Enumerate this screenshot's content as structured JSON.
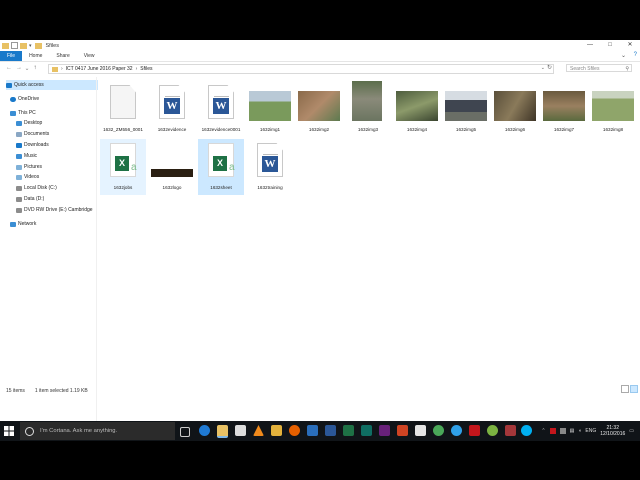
{
  "window": {
    "title": "Sfiles",
    "controls": {
      "minimize": "—",
      "maximize": "□",
      "close": "✕"
    }
  },
  "ribbon": {
    "tabs": [
      "File",
      "Home",
      "Share",
      "View"
    ],
    "help": "?"
  },
  "address": {
    "back": "←",
    "forward": "→",
    "recent": "⌄",
    "up": "↑",
    "path": [
      "ICT 0417 June 2016 Paper 32",
      "Sfiles"
    ],
    "separator": "›",
    "search_placeholder": "Search Sfiles"
  },
  "nav": {
    "items": [
      {
        "label": "Quick access",
        "icon": "star-icon",
        "color": "#1979ca"
      },
      {
        "label": "OneDrive",
        "icon": "cloud-icon",
        "color": "#1979ca"
      },
      {
        "label": "This PC",
        "icon": "computer-icon",
        "color": "#3b8ed4"
      },
      {
        "label": "Desktop",
        "icon": "desktop-icon",
        "color": "#3b8ed4"
      },
      {
        "label": "Documents",
        "icon": "documents-icon",
        "color": "#8aa7c4"
      },
      {
        "label": "Downloads",
        "icon": "download-icon",
        "color": "#1979ca"
      },
      {
        "label": "Music",
        "icon": "music-icon",
        "color": "#3b8ed4"
      },
      {
        "label": "Pictures",
        "icon": "pictures-icon",
        "color": "#7fb1d8"
      },
      {
        "label": "Videos",
        "icon": "videos-icon",
        "color": "#7fb1d8"
      },
      {
        "label": "Local Disk (C:)",
        "icon": "drive-icon",
        "color": "#8c8c8c"
      },
      {
        "label": "Data (D:)",
        "icon": "drive-icon",
        "color": "#8c8c8c"
      },
      {
        "label": "DVD RW Drive (E:) Cambridge",
        "icon": "dvd-icon",
        "color": "#8c8c8c"
      },
      {
        "label": "Network",
        "icon": "network-icon",
        "color": "#3b8ed4"
      }
    ]
  },
  "files": [
    {
      "name": "1632_ZM556_0001",
      "type": "blank"
    },
    {
      "name": "1632evidence",
      "type": "word"
    },
    {
      "name": "1632evidence0001",
      "type": "word"
    },
    {
      "name": "1632img1",
      "type": "image",
      "color": "#7a9a5c"
    },
    {
      "name": "1632img2",
      "type": "image",
      "color": "#8a6a4a"
    },
    {
      "name": "1632img3",
      "type": "image",
      "color": "#6b7560"
    },
    {
      "name": "1632img4",
      "type": "image",
      "color": "#4e5d3e"
    },
    {
      "name": "1632img5",
      "type": "image",
      "color": "#3f4550"
    },
    {
      "name": "1632img6",
      "type": "image",
      "color": "#5a4f3a"
    },
    {
      "name": "1632img7",
      "type": "image",
      "color": "#7a6448"
    },
    {
      "name": "1632img8",
      "type": "image",
      "color": "#8fa56a"
    },
    {
      "name": "1632jobs",
      "type": "excel"
    },
    {
      "name": "1632logo",
      "type": "logo",
      "color": "#2a1f12"
    },
    {
      "name": "1632sheet",
      "type": "excel"
    },
    {
      "name": "1632training",
      "type": "word"
    }
  ],
  "status": {
    "count": "15 items",
    "selection": "1 item selected  1.19 KB"
  },
  "taskbar": {
    "cortana": "I'm Cortana. Ask me anything.",
    "language": "ENG",
    "time": "21:32",
    "date": "12/10/2016"
  }
}
